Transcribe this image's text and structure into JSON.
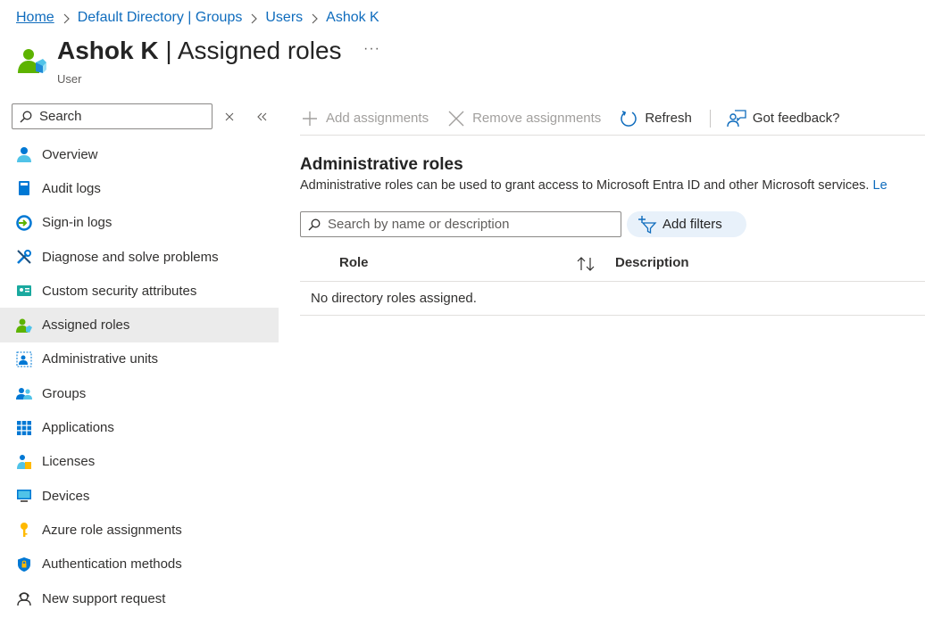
{
  "breadcrumb": {
    "items": [
      "Home",
      "Default Directory | Groups",
      "Users",
      "Ashok K"
    ]
  },
  "header": {
    "title_bold": "Ashok K",
    "title_rest": "| Assigned roles",
    "more": "···",
    "subtitle": "User"
  },
  "sidebar": {
    "search_placeholder": "Search",
    "items": [
      {
        "label": "Overview",
        "icon": "user-icon"
      },
      {
        "label": "Audit logs",
        "icon": "book-icon"
      },
      {
        "label": "Sign-in logs",
        "icon": "sign-in-icon"
      },
      {
        "label": "Diagnose and solve problems",
        "icon": "wrench-icon"
      },
      {
        "label": "Custom security attributes",
        "icon": "id-card-icon"
      },
      {
        "label": "Assigned roles",
        "icon": "user-roles-icon"
      },
      {
        "label": "Administrative units",
        "icon": "admin-units-icon"
      },
      {
        "label": "Groups",
        "icon": "groups-icon"
      },
      {
        "label": "Applications",
        "icon": "apps-grid-icon"
      },
      {
        "label": "Licenses",
        "icon": "license-icon"
      },
      {
        "label": "Devices",
        "icon": "monitor-icon"
      },
      {
        "label": "Azure role assignments",
        "icon": "key-icon"
      },
      {
        "label": "Authentication methods",
        "icon": "shield-icon"
      },
      {
        "label": "New support request",
        "icon": "support-icon"
      }
    ],
    "active_index": 5
  },
  "toolbar": {
    "add": "Add assignments",
    "remove": "Remove assignments",
    "refresh": "Refresh",
    "feedback": "Got feedback?"
  },
  "main": {
    "section_title": "Administrative roles",
    "section_desc": "Administrative roles can be used to grant access to Microsoft Entra ID and other Microsoft services.",
    "learn_more": "Le",
    "search_placeholder": "Search by name or description",
    "add_filters": "Add filters",
    "table": {
      "col_role": "Role",
      "col_desc": "Description",
      "empty_message": "No directory roles assigned."
    }
  },
  "colors": {
    "link": "#0f6cbd",
    "active_bg": "#ebebeb",
    "filter_pill_bg": "#e8f1fa"
  }
}
